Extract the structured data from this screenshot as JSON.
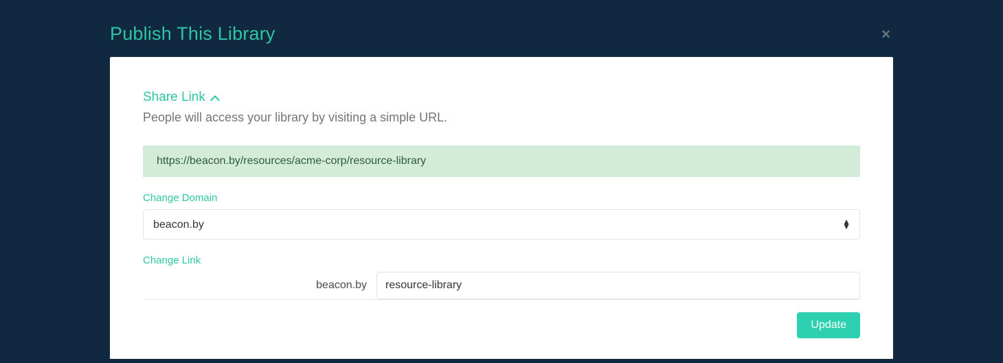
{
  "modal": {
    "title": "Publish This Library",
    "close_glyph": "×"
  },
  "share": {
    "section_label": "Share Link",
    "description": "People will access your library by visiting a simple URL.",
    "url": "https://beacon.by/resources/acme-corp/resource-library"
  },
  "domain": {
    "label": "Change Domain",
    "selected": "beacon.by"
  },
  "link": {
    "label": "Change Link",
    "prefix": "beacon.by",
    "value": "resource-library"
  },
  "actions": {
    "update_label": "Update"
  }
}
